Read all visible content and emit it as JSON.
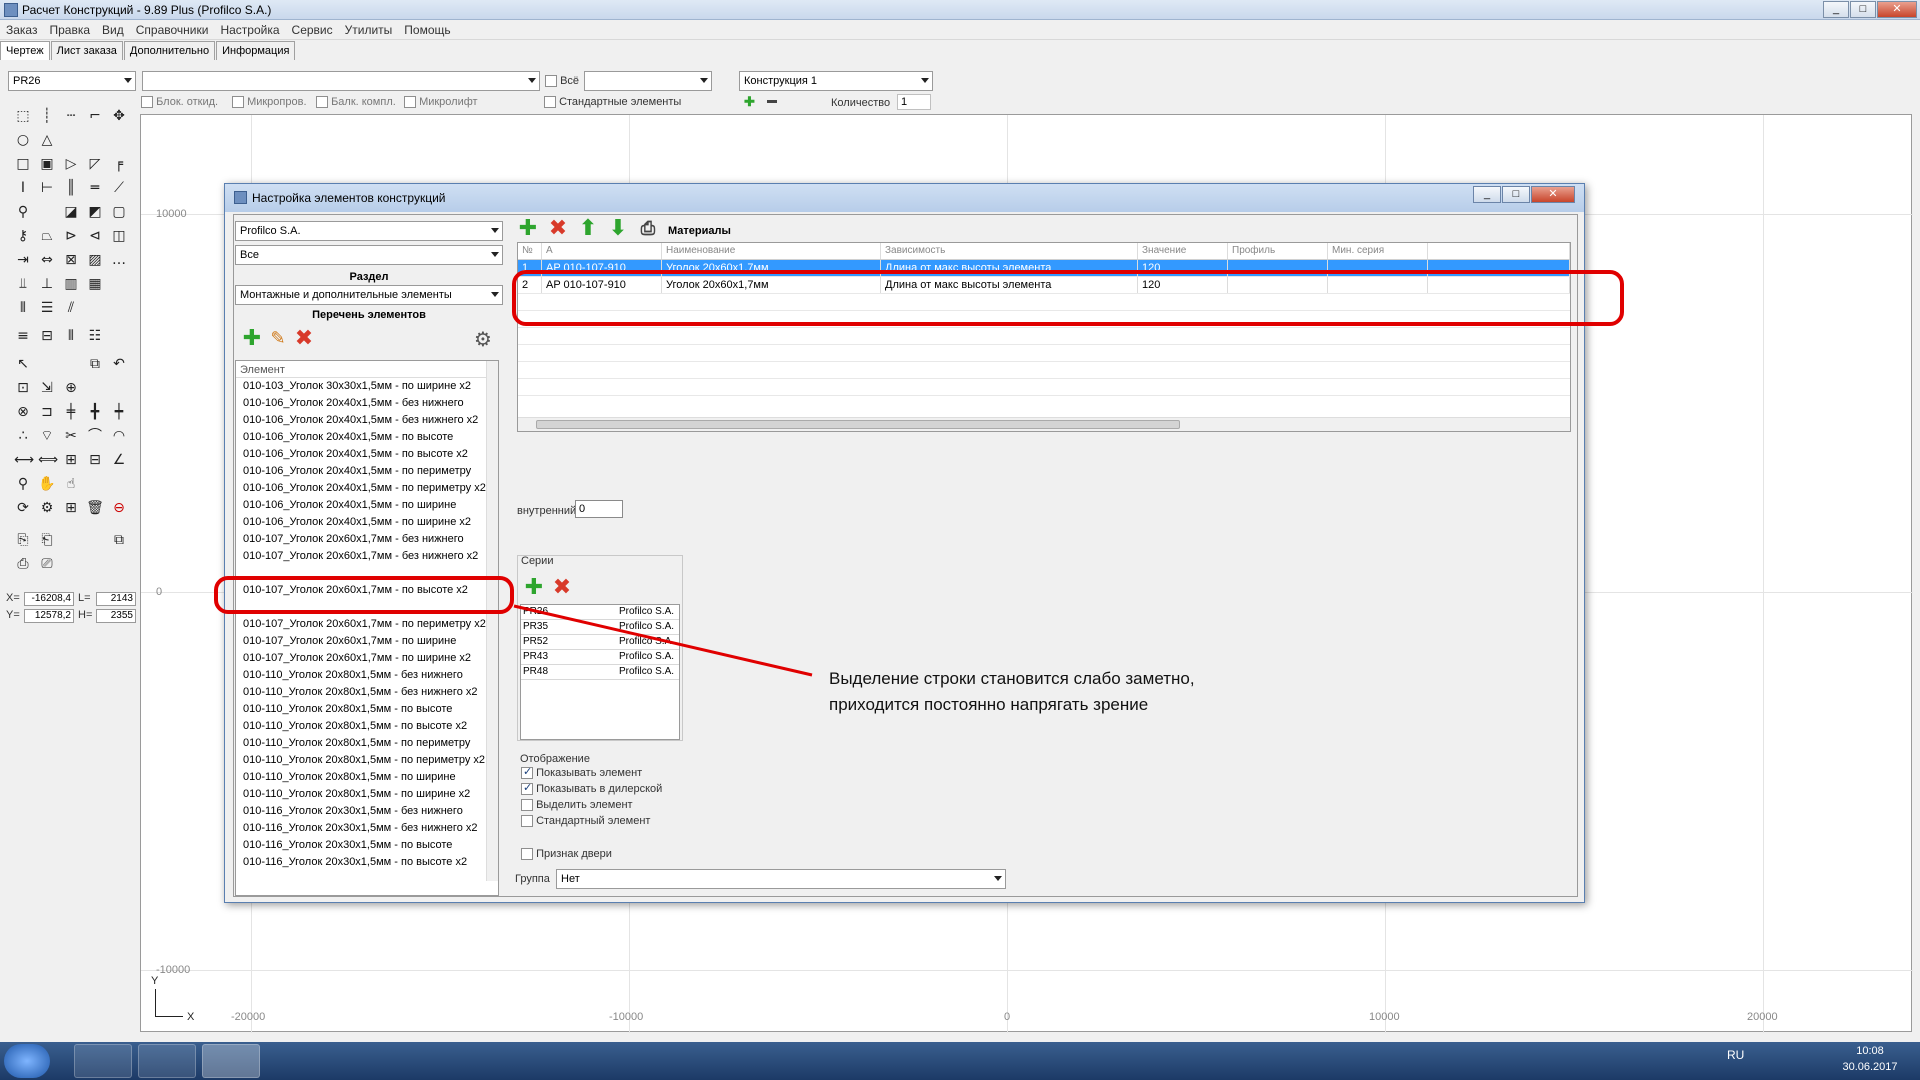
{
  "app": {
    "title": "Расчет Конструкций - 9.89 Plus (Profilco S.A.)",
    "min": "_",
    "max": "□",
    "close": "✕"
  },
  "menu": [
    "Заказ",
    "Правка",
    "Вид",
    "Справочники",
    "Настройка",
    "Сервис",
    "Утилиты",
    "Помощь"
  ],
  "tabs": [
    "Чертеж",
    "Лист заказа",
    "Дополнительно",
    "Информация"
  ],
  "toolbar": {
    "profile_combo": "PR26",
    "blank_combo": "",
    "all_label": "Всё",
    "all_combo": "",
    "construction_combo": "Конструкция 1",
    "chk_blok": "Блок. откид.",
    "chk_micro": "Микропров.",
    "chk_balk": "Балк. компл.",
    "chk_microlift": "Микролифт",
    "chk_standard": "Стандартные элементы",
    "qty_label": "Количество",
    "qty_value": "1",
    "plus_icon": "✚",
    "minus_icon": "▬"
  },
  "canvas": {
    "y_labels": [
      "10000",
      "0",
      "-10000"
    ],
    "x_labels": [
      "-20000",
      "-10000",
      "0",
      "10000",
      "20000"
    ],
    "axis_y": "Y",
    "axis_x": "X"
  },
  "coords": {
    "x_label": "X=",
    "x_value": "-16208,4",
    "l_label": "L=",
    "l_value": "2143",
    "y_label": "Y=",
    "y_value": "12578,2",
    "h_label": "H=",
    "h_value": "2355"
  },
  "dialog": {
    "title": "Настройка элементов конструкций",
    "supplier_combo": "Profilco S.A.",
    "filter_combo": "Все",
    "section_label": "Раздел",
    "section_combo": "Монтажные и дополнительные элементы",
    "list_label": "Перечень элементов",
    "list_header": "Элемент",
    "elements": [
      "010-103_Уголок 30х30х1,5мм - по ширине х2",
      "010-106_Уголок 20х40х1,5мм - без нижнего",
      "010-106_Уголок 20х40х1,5мм - без нижнего х2",
      "010-106_Уголок 20х40х1,5мм - по высоте",
      "010-106_Уголок 20х40х1,5мм - по высоте х2",
      "010-106_Уголок 20х40х1,5мм - по периметру",
      "010-106_Уголок 20х40х1,5мм - по периметру х2",
      "010-106_Уголок 20х40х1,5мм - по ширине",
      "010-106_Уголок 20х40х1,5мм - по ширине х2",
      "010-107_Уголок 20х60х1,7мм - без нижнего",
      "010-107_Уголок 20х60х1,7мм - без нижнего х2",
      "",
      "010-107_Уголок 20х60х1,7мм - по высоте х2",
      "",
      "010-107_Уголок 20х60х1,7мм - по периметру х2",
      "010-107_Уголок 20х60х1,7мм - по ширине",
      "010-107_Уголок 20х60х1,7мм - по ширине х2",
      "010-110_Уголок 20х80х1,5мм - без нижнего",
      "010-110_Уголок 20х80х1,5мм - без нижнего х2",
      "010-110_Уголок 20х80х1,5мм - по высоте",
      "010-110_Уголок 20х80х1,5мм - по высоте х2",
      "010-110_Уголок 20х80х1,5мм - по периметру",
      "010-110_Уголок 20х80х1,5мм - по периметру х2",
      "010-110_Уголок 20х80х1,5мм - по ширине",
      "010-110_Уголок 20х80х1,5мм - по ширине х2",
      "010-116_Уголок 20х30х1,5мм - без нижнего",
      "010-116_Уголок 20х30х1,5мм - без нижнего х2",
      "010-116_Уголок 20х30х1,5мм - по высоте",
      "010-116_Уголок 20х30х1,5мм - по высоте х2"
    ],
    "materials_label": "Материалы",
    "materials_header": [
      "№",
      "А",
      "Наименование",
      "Зависимость",
      "Значение",
      "Профиль",
      "Мин. серия",
      ""
    ],
    "materials_rows": [
      [
        "1",
        "AP 010-107-910",
        "Уголок 20х60х1,7мм",
        "Длина от макс высоты элемента",
        "120",
        "",
        "",
        ""
      ],
      [
        "2",
        "AP 010-107-910",
        "Уголок 20х60х1,7мм",
        "Длина от макс высоты элемента",
        "120",
        "",
        "",
        ""
      ]
    ],
    "inner_label": "внутренний",
    "inner_value": "0",
    "series_label": "Серии",
    "series": [
      [
        "PR26",
        "Profilco S.A."
      ],
      [
        "PR35",
        "Profilco S.A."
      ],
      [
        "PR52",
        "Profilco S.A."
      ],
      [
        "PR43",
        "Profilco S.A."
      ],
      [
        "PR48",
        "Profilco S.A."
      ]
    ],
    "display_label": "Отображение",
    "show_element": "Показывать элемент",
    "show_dealer": "Показывать в дилерской",
    "highlight_element": "Выделить элемент",
    "standard_element": "Стандартный элемент",
    "door_sign": "Признак двери",
    "group_label": "Группа",
    "group_combo": "Нет"
  },
  "annotation": {
    "line1": "Выделение строки становится слабо заметно,",
    "line2": "приходится постоянно напрягать зрение"
  },
  "taskbar": {
    "lang": "RU",
    "time": "10:08",
    "date": "30.06.2017"
  },
  "colors": {
    "selection": "#3399ff",
    "annotation_red": "#e00000",
    "taskbar": "#1c3a66"
  }
}
